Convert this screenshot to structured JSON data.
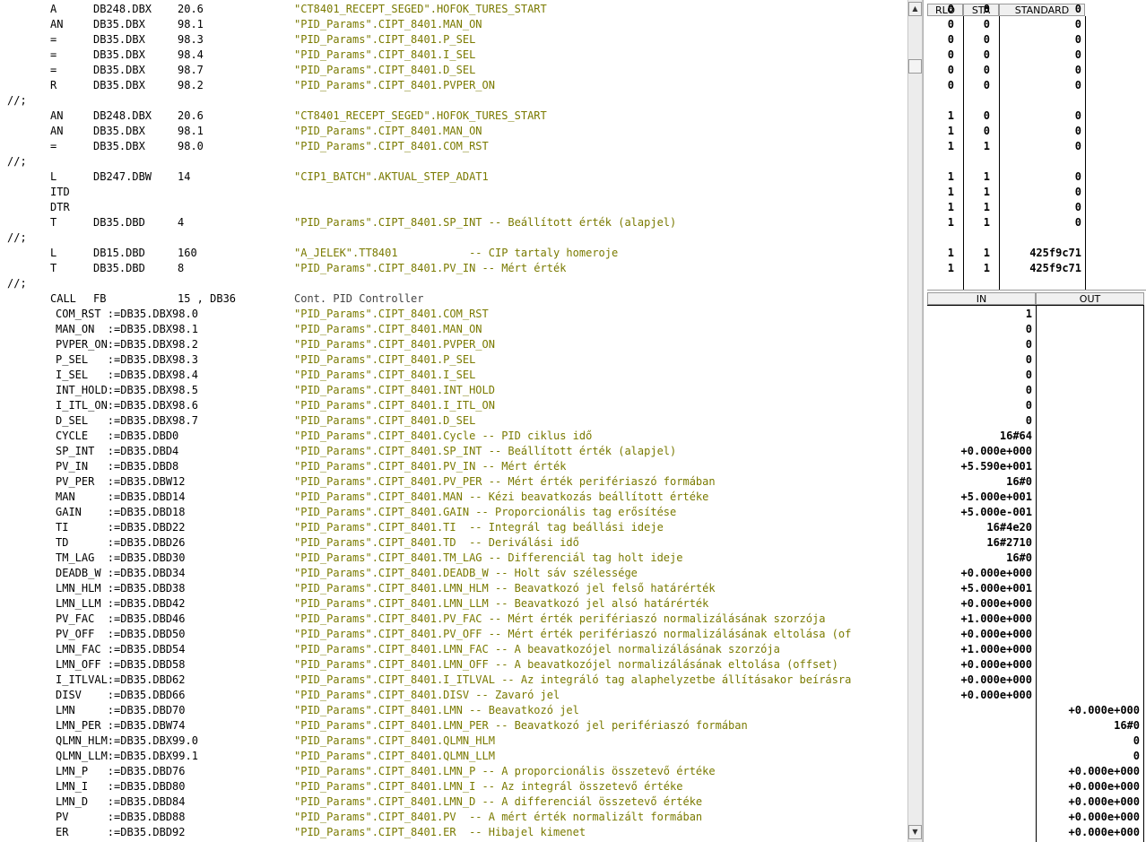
{
  "stl_lines": [
    {
      "row": 0,
      "op": "A",
      "addr": "DB248.DBX",
      "bit": "20.6",
      "sym": "\"CT8401_RECEPT_SEGED\".HOFOK_TURES_START"
    },
    {
      "row": 1,
      "op": "AN",
      "addr": "DB35.DBX",
      "bit": "98.1",
      "sym": "\"PID_Params\".CIPT_8401.MAN_ON"
    },
    {
      "row": 2,
      "op": "=",
      "addr": "DB35.DBX",
      "bit": "98.3",
      "sym": "\"PID_Params\".CIPT_8401.P_SEL"
    },
    {
      "row": 3,
      "op": "=",
      "addr": "DB35.DBX",
      "bit": "98.4",
      "sym": "\"PID_Params\".CIPT_8401.I_SEL"
    },
    {
      "row": 4,
      "op": "=",
      "addr": "DB35.DBX",
      "bit": "98.7",
      "sym": "\"PID_Params\".CIPT_8401.D_SEL"
    },
    {
      "row": 5,
      "op": "R",
      "addr": "DB35.DBX",
      "bit": "98.2",
      "sym": "\"PID_Params\".CIPT_8401.PVPER_ON"
    },
    {
      "row": 6,
      "label": "//;"
    },
    {
      "row": 7,
      "op": "AN",
      "addr": "DB248.DBX",
      "bit": "20.6",
      "sym": "\"CT8401_RECEPT_SEGED\".HOFOK_TURES_START"
    },
    {
      "row": 8,
      "op": "AN",
      "addr": "DB35.DBX",
      "bit": "98.1",
      "sym": "\"PID_Params\".CIPT_8401.MAN_ON"
    },
    {
      "row": 9,
      "op": "=",
      "addr": "DB35.DBX",
      "bit": "98.0",
      "sym": "\"PID_Params\".CIPT_8401.COM_RST"
    },
    {
      "row": 10,
      "label": "//;"
    },
    {
      "row": 11,
      "op": "L",
      "addr": "DB247.DBW",
      "bit": "14",
      "sym": "\"CIP1_BATCH\".AKTUAL_STEP_ADAT1"
    },
    {
      "row": 12,
      "op": "ITD"
    },
    {
      "row": 13,
      "op": "DTR"
    },
    {
      "row": 14,
      "op": "T",
      "addr": "DB35.DBD",
      "bit": "4",
      "sym": "\"PID_Params\".CIPT_8401.SP_INT -- Beállított érték (alapjel)"
    },
    {
      "row": 15,
      "label": "//;"
    },
    {
      "row": 16,
      "op": "L",
      "addr": "DB15.DBD",
      "bit": "160",
      "sym": "\"A_JELEK\".TT8401           -- CIP tartaly homeroje"
    },
    {
      "row": 17,
      "op": "T",
      "addr": "DB35.DBD",
      "bit": "8",
      "sym": "\"PID_Params\".CIPT_8401.PV_IN -- Mért érték"
    },
    {
      "row": 18,
      "label": "//;"
    },
    {
      "row": 19,
      "op": "CALL",
      "addr": "FB",
      "bit": "15 , DB36",
      "sym": "Cont. PID Controller",
      "plain": true
    },
    {
      "row": 20,
      "param": "COM_RST :=DB35.DBX98.0",
      "sym": "\"PID_Params\".CIPT_8401.COM_RST"
    },
    {
      "row": 21,
      "param": "MAN_ON  :=DB35.DBX98.1",
      "sym": "\"PID_Params\".CIPT_8401.MAN_ON"
    },
    {
      "row": 22,
      "param": "PVPER_ON:=DB35.DBX98.2",
      "sym": "\"PID_Params\".CIPT_8401.PVPER_ON"
    },
    {
      "row": 23,
      "param": "P_SEL   :=DB35.DBX98.3",
      "sym": "\"PID_Params\".CIPT_8401.P_SEL"
    },
    {
      "row": 24,
      "param": "I_SEL   :=DB35.DBX98.4",
      "sym": "\"PID_Params\".CIPT_8401.I_SEL"
    },
    {
      "row": 25,
      "param": "INT_HOLD:=DB35.DBX98.5",
      "sym": "\"PID_Params\".CIPT_8401.INT_HOLD"
    },
    {
      "row": 26,
      "param": "I_ITL_ON:=DB35.DBX98.6",
      "sym": "\"PID_Params\".CIPT_8401.I_ITL_ON"
    },
    {
      "row": 27,
      "param": "D_SEL   :=DB35.DBX98.7",
      "sym": "\"PID_Params\".CIPT_8401.D_SEL"
    },
    {
      "row": 28,
      "param": "CYCLE   :=DB35.DBD0",
      "sym": "\"PID_Params\".CIPT_8401.Cycle -- PID ciklus idő"
    },
    {
      "row": 29,
      "param": "SP_INT  :=DB35.DBD4",
      "sym": "\"PID_Params\".CIPT_8401.SP_INT -- Beállított érték (alapjel)"
    },
    {
      "row": 30,
      "param": "PV_IN   :=DB35.DBD8",
      "sym": "\"PID_Params\".CIPT_8401.PV_IN -- Mért érték"
    },
    {
      "row": 31,
      "param": "PV_PER  :=DB35.DBW12",
      "sym": "\"PID_Params\".CIPT_8401.PV_PER -- Mért érték perifériaszó formában"
    },
    {
      "row": 32,
      "param": "MAN     :=DB35.DBD14",
      "sym": "\"PID_Params\".CIPT_8401.MAN -- Kézi beavatkozás beállított értéke"
    },
    {
      "row": 33,
      "param": "GAIN    :=DB35.DBD18",
      "sym": "\"PID_Params\".CIPT_8401.GAIN -- Proporcionális tag erősítése"
    },
    {
      "row": 34,
      "param": "TI      :=DB35.DBD22",
      "sym": "\"PID_Params\".CIPT_8401.TI  -- Integrál tag beállási ideje"
    },
    {
      "row": 35,
      "param": "TD      :=DB35.DBD26",
      "sym": "\"PID_Params\".CIPT_8401.TD  -- Deriválási idő"
    },
    {
      "row": 36,
      "param": "TM_LAG  :=DB35.DBD30",
      "sym": "\"PID_Params\".CIPT_8401.TM_LAG -- Differenciál tag holt ideje"
    },
    {
      "row": 37,
      "param": "DEADB_W :=DB35.DBD34",
      "sym": "\"PID_Params\".CIPT_8401.DEADB_W -- Holt sáv szélessége"
    },
    {
      "row": 38,
      "param": "LMN_HLM :=DB35.DBD38",
      "sym": "\"PID_Params\".CIPT_8401.LMN_HLM -- Beavatkozó jel felső határérték"
    },
    {
      "row": 39,
      "param": "LMN_LLM :=DB35.DBD42",
      "sym": "\"PID_Params\".CIPT_8401.LMN_LLM -- Beavatkozó jel alsó határérték"
    },
    {
      "row": 40,
      "param": "PV_FAC  :=DB35.DBD46",
      "sym": "\"PID_Params\".CIPT_8401.PV_FAC -- Mért érték perifériaszó normalizálásának szorzója"
    },
    {
      "row": 41,
      "param": "PV_OFF  :=DB35.DBD50",
      "sym": "\"PID_Params\".CIPT_8401.PV_OFF -- Mért érték perifériaszó normalizálásának eltolása (of"
    },
    {
      "row": 42,
      "param": "LMN_FAC :=DB35.DBD54",
      "sym": "\"PID_Params\".CIPT_8401.LMN_FAC -- A beavatkozójel normalizálásának szorzója"
    },
    {
      "row": 43,
      "param": "LMN_OFF :=DB35.DBD58",
      "sym": "\"PID_Params\".CIPT_8401.LMN_OFF -- A beavatkozójel normalizálásának eltolása (offset)"
    },
    {
      "row": 44,
      "param": "I_ITLVAL:=DB35.DBD62",
      "sym": "\"PID_Params\".CIPT_8401.I_ITLVAL -- Az integráló tag alaphelyzetbe állításakor beírásra"
    },
    {
      "row": 45,
      "param": "DISV    :=DB35.DBD66",
      "sym": "\"PID_Params\".CIPT_8401.DISV -- Zavaró jel"
    },
    {
      "row": 46,
      "param": "LMN     :=DB35.DBD70",
      "sym": "\"PID_Params\".CIPT_8401.LMN -- Beavatkozó jel"
    },
    {
      "row": 47,
      "param": "LMN_PER :=DB35.DBW74",
      "sym": "\"PID_Params\".CIPT_8401.LMN_PER -- Beavatkozó jel perifériaszó formában"
    },
    {
      "row": 48,
      "param": "QLMN_HLM:=DB35.DBX99.0",
      "sym": "\"PID_Params\".CIPT_8401.QLMN_HLM"
    },
    {
      "row": 49,
      "param": "QLMN_LLM:=DB35.DBX99.1",
      "sym": "\"PID_Params\".CIPT_8401.QLMN_LLM"
    },
    {
      "row": 50,
      "param": "LMN_P   :=DB35.DBD76",
      "sym": "\"PID_Params\".CIPT_8401.LMN_P -- A proporcionális összetevő értéke"
    },
    {
      "row": 51,
      "param": "LMN_I   :=DB35.DBD80",
      "sym": "\"PID_Params\".CIPT_8401.LMN_I -- Az integrál összetevő értéke"
    },
    {
      "row": 52,
      "param": "LMN_D   :=DB35.DBD84",
      "sym": "\"PID_Params\".CIPT_8401.LMN_D -- A differenciál összetevő értéke"
    },
    {
      "row": 53,
      "param": "PV      :=DB35.DBD88",
      "sym": "\"PID_Params\".CIPT_8401.PV  -- A mért érték normalizált formában"
    },
    {
      "row": 54,
      "param": "ER      :=DB35.DBD92",
      "sym": "\"PID_Params\".CIPT_8401.ER  -- Hibajel kimenet"
    }
  ],
  "status_headers": {
    "rlo": "RLO",
    "sta": "STA",
    "standard": "STANDARD",
    "in": "IN",
    "out": "OUT"
  },
  "status_rows": [
    {
      "row": 0,
      "rlo": "0",
      "sta": "0",
      "std": "0"
    },
    {
      "row": 1,
      "rlo": "0",
      "sta": "0",
      "std": "0"
    },
    {
      "row": 2,
      "rlo": "0",
      "sta": "0",
      "std": "0"
    },
    {
      "row": 3,
      "rlo": "0",
      "sta": "0",
      "std": "0"
    },
    {
      "row": 4,
      "rlo": "0",
      "sta": "0",
      "std": "0"
    },
    {
      "row": 5,
      "rlo": "0",
      "sta": "0",
      "std": "0"
    },
    {
      "row": 7,
      "rlo": "1",
      "sta": "0",
      "std": "0"
    },
    {
      "row": 8,
      "rlo": "1",
      "sta": "0",
      "std": "0"
    },
    {
      "row": 9,
      "rlo": "1",
      "sta": "1",
      "std": "0"
    },
    {
      "row": 11,
      "rlo": "1",
      "sta": "1",
      "std": "0"
    },
    {
      "row": 12,
      "rlo": "1",
      "sta": "1",
      "std": "0"
    },
    {
      "row": 13,
      "rlo": "1",
      "sta": "1",
      "std": "0"
    },
    {
      "row": 14,
      "rlo": "1",
      "sta": "1",
      "std": "0"
    },
    {
      "row": 16,
      "rlo": "1",
      "sta": "1",
      "std": "425f9c71"
    },
    {
      "row": 17,
      "rlo": "1",
      "sta": "1",
      "std": "425f9c71"
    }
  ],
  "io_rows": [
    {
      "row": 20,
      "in": "1"
    },
    {
      "row": 21,
      "in": "0"
    },
    {
      "row": 22,
      "in": "0"
    },
    {
      "row": 23,
      "in": "0"
    },
    {
      "row": 24,
      "in": "0"
    },
    {
      "row": 25,
      "in": "0"
    },
    {
      "row": 26,
      "in": "0"
    },
    {
      "row": 27,
      "in": "0"
    },
    {
      "row": 28,
      "in": "16#64"
    },
    {
      "row": 29,
      "in": "+0.000e+000"
    },
    {
      "row": 30,
      "in": "+5.590e+001"
    },
    {
      "row": 31,
      "in": "16#0"
    },
    {
      "row": 32,
      "in": "+5.000e+001"
    },
    {
      "row": 33,
      "in": "+5.000e-001"
    },
    {
      "row": 34,
      "in": "16#4e20"
    },
    {
      "row": 35,
      "in": "16#2710"
    },
    {
      "row": 36,
      "in": "16#0"
    },
    {
      "row": 37,
      "in": "+0.000e+000"
    },
    {
      "row": 38,
      "in": "+5.000e+001"
    },
    {
      "row": 39,
      "in": "+0.000e+000"
    },
    {
      "row": 40,
      "in": "+1.000e+000"
    },
    {
      "row": 41,
      "in": "+0.000e+000"
    },
    {
      "row": 42,
      "in": "+1.000e+000"
    },
    {
      "row": 43,
      "in": "+0.000e+000"
    },
    {
      "row": 44,
      "in": "+0.000e+000"
    },
    {
      "row": 45,
      "in": "+0.000e+000"
    },
    {
      "row": 46,
      "out": "+0.000e+000"
    },
    {
      "row": 47,
      "out": "16#0"
    },
    {
      "row": 48,
      "out": "0"
    },
    {
      "row": 49,
      "out": "0"
    },
    {
      "row": 50,
      "out": "+0.000e+000"
    },
    {
      "row": 51,
      "out": "+0.000e+000"
    },
    {
      "row": 52,
      "out": "+0.000e+000"
    },
    {
      "row": 53,
      "out": "+0.000e+000"
    },
    {
      "row": 54,
      "out": "+0.000e+000"
    }
  ],
  "scrollbar": {
    "up": "▲",
    "down": "▼"
  }
}
